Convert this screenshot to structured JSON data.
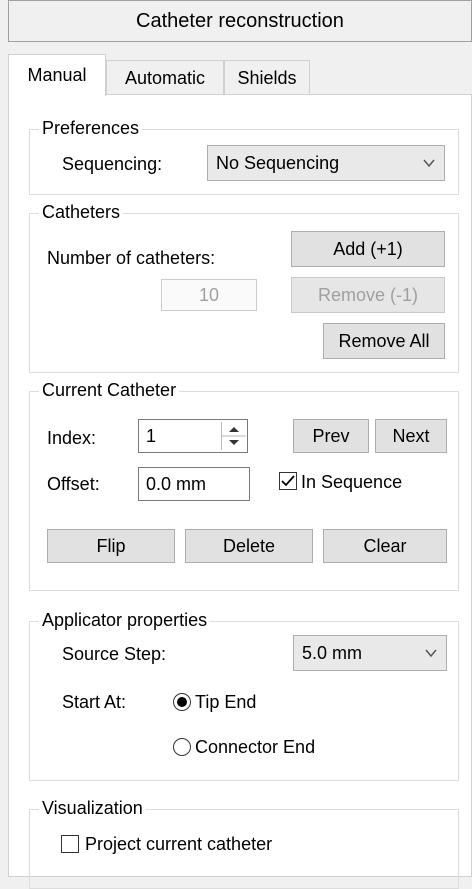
{
  "title": "Catheter reconstruction",
  "tabs": [
    {
      "label": "Manual",
      "active": true
    },
    {
      "label": "Automatic",
      "active": false
    },
    {
      "label": "Shields",
      "active": false
    }
  ],
  "preferences": {
    "legend": "Preferences",
    "sequencing_label": "Sequencing:",
    "sequencing_value": "No Sequencing"
  },
  "catheters": {
    "legend": "Catheters",
    "count_label": "Number of catheters:",
    "count_value": "10",
    "add_label": "Add (+1)",
    "remove_label": "Remove (-1)",
    "remove_all_label": "Remove All"
  },
  "current": {
    "legend": "Current Catheter",
    "index_label": "Index:",
    "index_value": "1",
    "prev_label": "Prev",
    "next_label": "Next",
    "offset_label": "Offset:",
    "offset_value": "0.0 mm",
    "in_sequence_label": "In Sequence",
    "in_sequence_checked": true,
    "flip_label": "Flip",
    "delete_label": "Delete",
    "clear_label": "Clear"
  },
  "applicator": {
    "legend": "Applicator properties",
    "source_step_label": "Source Step:",
    "source_step_value": "5.0 mm",
    "start_at_label": "Start At:",
    "tip_end_label": "Tip End",
    "connector_end_label": "Connector End",
    "selected": "Tip End"
  },
  "visualization": {
    "legend": "Visualization",
    "project_label": "Project current catheter",
    "project_checked": false
  }
}
